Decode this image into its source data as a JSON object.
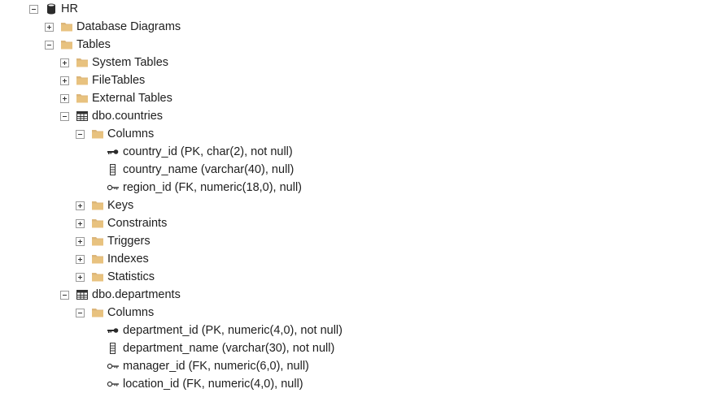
{
  "tree": {
    "db": {
      "label": "HR",
      "icon": "database-icon",
      "expanded": true
    },
    "db_diagrams": {
      "label": "Database Diagrams",
      "icon": "folder-icon",
      "expanded": false
    },
    "tables": {
      "label": "Tables",
      "icon": "folder-icon",
      "expanded": true
    },
    "system_tables": {
      "label": "System Tables",
      "icon": "folder-icon",
      "expanded": false
    },
    "filetables": {
      "label": "FileTables",
      "icon": "folder-icon",
      "expanded": false
    },
    "external_tables": {
      "label": "External Tables",
      "icon": "folder-icon",
      "expanded": false
    },
    "countries": {
      "label": "dbo.countries",
      "icon": "table-icon",
      "expanded": true,
      "columns_folder": "Columns",
      "columns": [
        {
          "label": "country_id (PK, char(2), not null)",
          "icon": "primary-key-icon"
        },
        {
          "label": "country_name (varchar(40), null)",
          "icon": "column-icon"
        },
        {
          "label": "region_id (FK, numeric(18,0), null)",
          "icon": "foreign-key-icon"
        }
      ],
      "folders": [
        "Keys",
        "Constraints",
        "Triggers",
        "Indexes",
        "Statistics"
      ]
    },
    "departments": {
      "label": "dbo.departments",
      "icon": "table-icon",
      "expanded": true,
      "columns_folder": "Columns",
      "columns": [
        {
          "label": "department_id (PK, numeric(4,0), not null)",
          "icon": "primary-key-icon"
        },
        {
          "label": "department_name (varchar(30), not null)",
          "icon": "column-icon"
        },
        {
          "label": "manager_id (FK, numeric(6,0), null)",
          "icon": "foreign-key-icon"
        },
        {
          "label": "location_id (FK, numeric(4,0), null)",
          "icon": "foreign-key-icon"
        }
      ]
    }
  },
  "colors": {
    "folder": "#dcb67a",
    "folder_dark": "#c79a45",
    "text": "#1e1e1e",
    "expander_border": "#9a9a9a"
  }
}
